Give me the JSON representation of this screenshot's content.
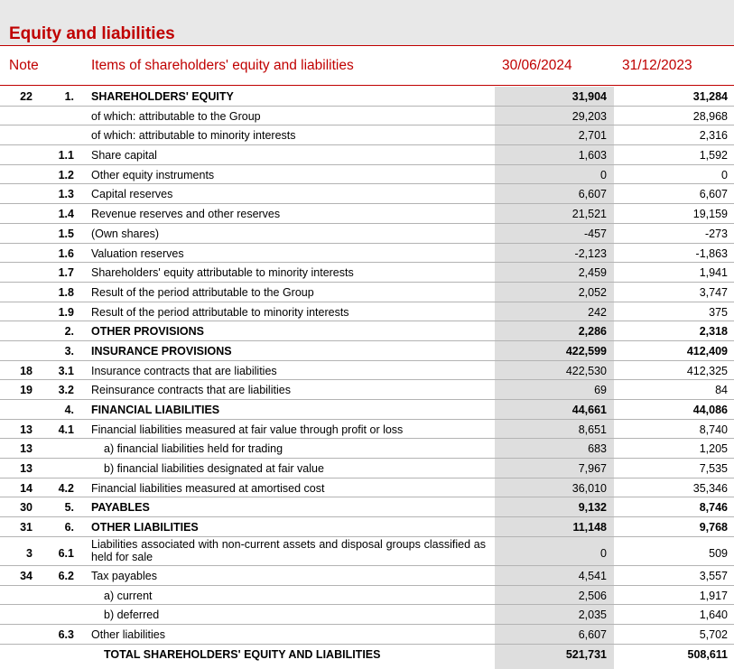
{
  "title": "Equity and liabilities",
  "headers": {
    "note": "Note",
    "items": "Items of shareholders' equity and liabilities",
    "col1": "30/06/2024",
    "col2": "31/12/2023"
  },
  "colors": {
    "accent": "#c00000",
    "shade": "#dedede",
    "title_band": "#e8e8e8"
  },
  "rows": [
    {
      "note": "22",
      "num": "1.",
      "label": "SHAREHOLDERS' EQUITY",
      "v1": "31,904",
      "v2": "31,284",
      "bold": true,
      "indent": 0
    },
    {
      "note": "",
      "num": "",
      "label": "of which: attributable to the Group",
      "v1": "29,203",
      "v2": "28,968",
      "bold": false,
      "indent": 0
    },
    {
      "note": "",
      "num": "",
      "label": "of which: attributable to minority interests",
      "v1": "2,701",
      "v2": "2,316",
      "bold": false,
      "indent": 0
    },
    {
      "note": "",
      "num": "1.1",
      "label": "Share capital",
      "v1": "1,603",
      "v2": "1,592",
      "bold": false,
      "indent": 0
    },
    {
      "note": "",
      "num": "1.2",
      "label": "Other equity instruments",
      "v1": "0",
      "v2": "0",
      "bold": false,
      "indent": 0
    },
    {
      "note": "",
      "num": "1.3",
      "label": "Capital reserves",
      "v1": "6,607",
      "v2": "6,607",
      "bold": false,
      "indent": 0
    },
    {
      "note": "",
      "num": "1.4",
      "label": "Revenue reserves and other reserves",
      "v1": "21,521",
      "v2": "19,159",
      "bold": false,
      "indent": 0
    },
    {
      "note": "",
      "num": "1.5",
      "label": "(Own shares)",
      "v1": "-457",
      "v2": "-273",
      "bold": false,
      "indent": 0
    },
    {
      "note": "",
      "num": "1.6",
      "label": "Valuation reserves",
      "v1": "-2,123",
      "v2": "-1,863",
      "bold": false,
      "indent": 0
    },
    {
      "note": "",
      "num": "1.7",
      "label": "Shareholders' equity attributable to minority interests",
      "v1": "2,459",
      "v2": "1,941",
      "bold": false,
      "indent": 0
    },
    {
      "note": "",
      "num": "1.8",
      "label": "Result of the period attributable to the Group",
      "v1": "2,052",
      "v2": "3,747",
      "bold": false,
      "indent": 0
    },
    {
      "note": "",
      "num": "1.9",
      "label": "Result of the period attributable to minority interests",
      "v1": "242",
      "v2": "375",
      "bold": false,
      "indent": 0
    },
    {
      "note": "",
      "num": "2.",
      "label": "OTHER PROVISIONS",
      "v1": "2,286",
      "v2": "2,318",
      "bold": true,
      "indent": 0
    },
    {
      "note": "",
      "num": "3.",
      "label": "INSURANCE PROVISIONS",
      "v1": "422,599",
      "v2": "412,409",
      "bold": true,
      "indent": 0
    },
    {
      "note": "18",
      "num": "3.1",
      "label": "Insurance contracts that are liabilities",
      "v1": "422,530",
      "v2": "412,325",
      "bold": false,
      "indent": 0
    },
    {
      "note": "19",
      "num": "3.2",
      "label": "Reinsurance contracts that are liabilities",
      "v1": "69",
      "v2": "84",
      "bold": false,
      "indent": 0
    },
    {
      "note": "",
      "num": "4.",
      "label": "FINANCIAL LIABILITIES",
      "v1": "44,661",
      "v2": "44,086",
      "bold": true,
      "indent": 0
    },
    {
      "note": "13",
      "num": "4.1",
      "label": "Financial liabilities measured at fair value through profit or loss",
      "v1": "8,651",
      "v2": "8,740",
      "bold": false,
      "indent": 0
    },
    {
      "note": "13",
      "num": "",
      "label": "a) financial liabilities held for trading",
      "v1": "683",
      "v2": "1,205",
      "bold": false,
      "indent": 1
    },
    {
      "note": "13",
      "num": "",
      "label": "b) financial liabilities designated at fair value",
      "v1": "7,967",
      "v2": "7,535",
      "bold": false,
      "indent": 1
    },
    {
      "note": "14",
      "num": "4.2",
      "label": "Financial liabilities measured at amortised cost",
      "v1": "36,010",
      "v2": "35,346",
      "bold": false,
      "indent": 0
    },
    {
      "note": "30",
      "num": "5.",
      "label": " PAYABLES",
      "v1": "9,132",
      "v2": "8,746",
      "bold": true,
      "indent": 0
    },
    {
      "note": "31",
      "num": "6.",
      "label": "OTHER LIABILITIES",
      "v1": "11,148",
      "v2": "9,768",
      "bold": true,
      "indent": 0
    },
    {
      "note": "3",
      "num": "6.1",
      "label": "Liabilities associated with non-current assets and disposal groups classified as held for sale",
      "v1": "0",
      "v2": "509",
      "bold": false,
      "indent": 0,
      "tall": true
    },
    {
      "note": "34",
      "num": "6.2",
      "label": "Tax payables",
      "v1": "4,541",
      "v2": "3,557",
      "bold": false,
      "indent": 0
    },
    {
      "note": "",
      "num": "",
      "label": "a) current",
      "v1": "2,506",
      "v2": "1,917",
      "bold": false,
      "indent": 1
    },
    {
      "note": "",
      "num": "",
      "label": "b) deferred",
      "v1": "2,035",
      "v2": "1,640",
      "bold": false,
      "indent": 1
    },
    {
      "note": "",
      "num": "6.3",
      "label": "Other liabilities",
      "v1": "6,607",
      "v2": "5,702",
      "bold": false,
      "indent": 0
    },
    {
      "note": "",
      "num": "",
      "label": "TOTAL SHAREHOLDERS' EQUITY AND LIABILITIES",
      "v1": "521,731",
      "v2": "508,611",
      "bold": true,
      "indent": 2
    }
  ]
}
